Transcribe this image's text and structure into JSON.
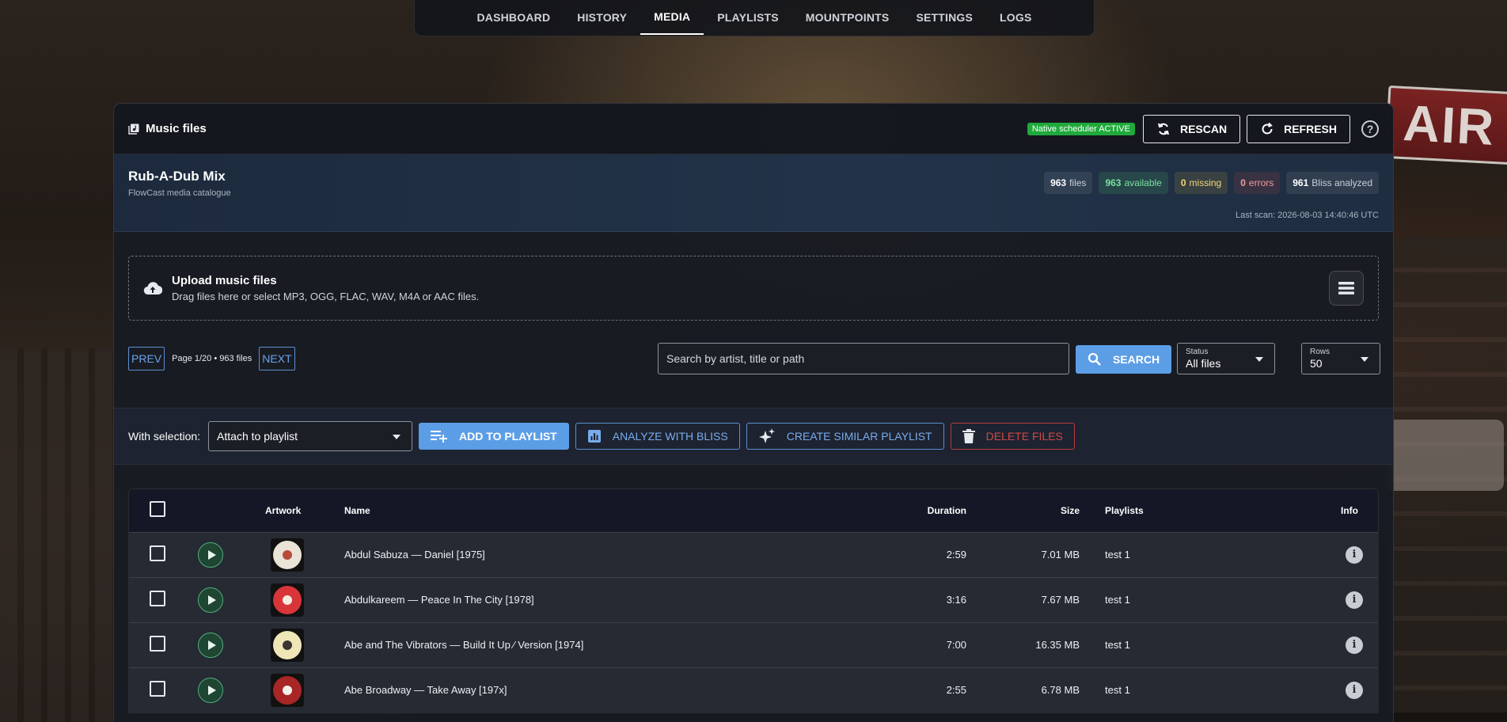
{
  "nav": {
    "items": [
      "DASHBOARD",
      "HISTORY",
      "MEDIA",
      "PLAYLISTS",
      "MOUNTPOINTS",
      "SETTINGS",
      "LOGS"
    ],
    "active": "MEDIA"
  },
  "card": {
    "title": "Music files",
    "scheduler_badge": "Native scheduler ACTIVE",
    "rescan_label": "RESCAN",
    "refresh_label": "REFRESH",
    "help_glyph": "?"
  },
  "summary": {
    "title": "Rub-A-Dub Mix",
    "subtitle": "FlowCast media catalogue",
    "files_count": "963",
    "files_label": "files",
    "available_count": "963",
    "available_label": "available",
    "missing_count": "0",
    "missing_label": "missing",
    "errors_count": "0",
    "errors_label": "errors",
    "bliss_count": "961",
    "bliss_label": "Bliss analyzed",
    "last_scan": "Last scan: 2026-08-03 14:40:46 UTC"
  },
  "upload": {
    "title": "Upload music files",
    "subtitle": "Drag files here or select MP3, OGG, FLAC, WAV, M4A or AAC files."
  },
  "toolbar": {
    "prev_label": "PREV",
    "page_info": "Page 1/20 • 963 files",
    "next_label": "NEXT",
    "search_placeholder": "Search by artist, title or path",
    "search_label": "SEARCH",
    "status_label": "Status",
    "status_value": "All files",
    "rows_label": "Rows",
    "rows_value": "50"
  },
  "selection": {
    "label": "With selection:",
    "attach_value": "Attach to playlist",
    "add_to_playlist": "ADD TO PLAYLIST",
    "analyze": "ANALYZE WITH BLISS",
    "create_similar": "CREATE SIMILAR PLAYLIST",
    "delete": "DELETE FILES"
  },
  "table": {
    "columns": {
      "artwork": "Artwork",
      "name": "Name",
      "duration": "Duration",
      "size": "Size",
      "playlists": "Playlists",
      "info": "Info"
    },
    "rows": [
      {
        "name": "Abdul Sabuza — Daniel [1975]",
        "duration": "2:59",
        "size": "7.01 MB",
        "playlists": "test 1",
        "record_color": "#e9e3d8",
        "center_color": "#b84a3a"
      },
      {
        "name": "Abdulkareem — Peace In The City [1978]",
        "duration": "3:16",
        "size": "7.67 MB",
        "playlists": "test 1",
        "record_color": "#d8353a",
        "center_color": "#f2ecdf"
      },
      {
        "name": "Abe and The Vibrators — Build It Up ⁄ Version [1974]",
        "duration": "7:00",
        "size": "16.35 MB",
        "playlists": "test 1",
        "record_color": "#efe6b8",
        "center_color": "#3a3530"
      },
      {
        "name": "Abe Broadway — Take Away [197x]",
        "duration": "2:55",
        "size": "6.78 MB",
        "playlists": "test 1",
        "record_color": "#a82626",
        "center_color": "#f4f1ea"
      }
    ]
  },
  "colors": {
    "accent": "#5c9ee6",
    "danger": "#d04848",
    "success": "#1faa3b"
  },
  "icons": [
    "music-library-icon",
    "rescan-icon",
    "refresh-icon",
    "help-icon",
    "upload-cloud-icon",
    "queue-list-icon",
    "search-icon",
    "playlist-add-icon",
    "analytics-icon",
    "sparkles-icon",
    "trash-icon",
    "play-icon",
    "info-icon",
    "chevron-down-icon"
  ]
}
